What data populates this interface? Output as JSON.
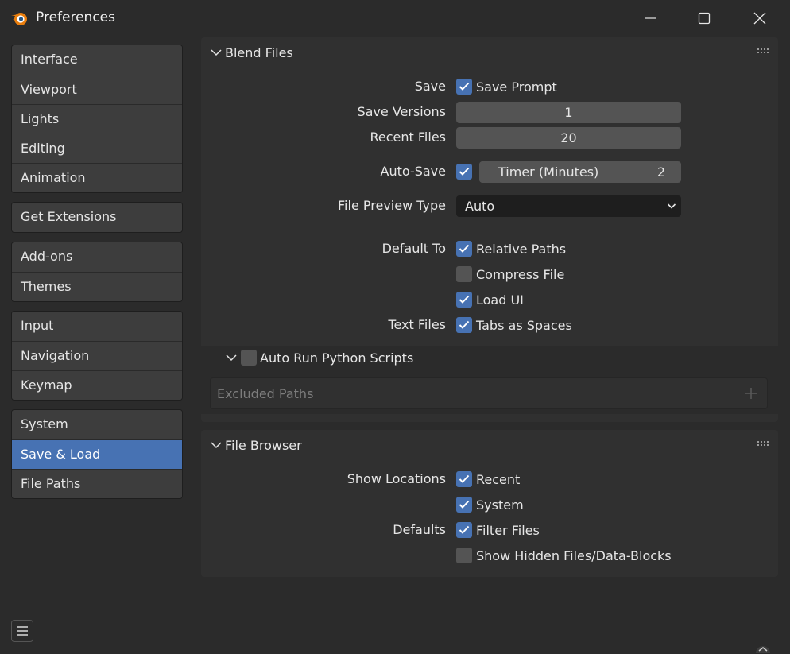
{
  "window": {
    "title": "Preferences"
  },
  "sidebar": {
    "groups": [
      [
        "Interface",
        "Viewport",
        "Lights",
        "Editing",
        "Animation"
      ],
      [
        "Get Extensions"
      ],
      [
        "Add-ons",
        "Themes"
      ],
      [
        "Input",
        "Navigation",
        "Keymap"
      ],
      [
        "System",
        "Save & Load",
        "File Paths"
      ]
    ],
    "items": {
      "interface": "Interface",
      "viewport": "Viewport",
      "lights": "Lights",
      "editing": "Editing",
      "animation": "Animation",
      "get_extensions": "Get Extensions",
      "addons": "Add-ons",
      "themes": "Themes",
      "input": "Input",
      "navigation": "Navigation",
      "keymap": "Keymap",
      "system": "System",
      "save_load": "Save & Load",
      "file_paths": "File Paths"
    },
    "active": "Save & Load"
  },
  "blend_files": {
    "title": "Blend Files",
    "save_label": "Save",
    "save_prompt": {
      "label": "Save Prompt",
      "checked": true
    },
    "save_versions": {
      "label": "Save Versions",
      "value": "1"
    },
    "recent_files": {
      "label": "Recent Files",
      "value": "20"
    },
    "auto_save": {
      "label": "Auto-Save",
      "checked": true,
      "timer_label": "Timer (Minutes)",
      "timer_value": "2"
    },
    "file_preview_type": {
      "label": "File Preview Type",
      "value": "Auto"
    },
    "default_to_label": "Default To",
    "relative_paths": {
      "label": "Relative Paths",
      "checked": true
    },
    "compress_file": {
      "label": "Compress File",
      "checked": false
    },
    "load_ui": {
      "label": "Load UI",
      "checked": true
    },
    "text_files_label": "Text Files",
    "tabs_as_spaces": {
      "label": "Tabs as Spaces",
      "checked": true
    },
    "auto_run": {
      "label": "Auto Run Python Scripts",
      "checked": false
    },
    "excluded_paths": "Excluded Paths"
  },
  "file_browser": {
    "title": "File Browser",
    "show_locations_label": "Show Locations",
    "recent": {
      "label": "Recent",
      "checked": true
    },
    "system": {
      "label": "System",
      "checked": true
    },
    "defaults_label": "Defaults",
    "filter_files": {
      "label": "Filter Files",
      "checked": true
    },
    "show_hidden": {
      "label": "Show Hidden Files/Data-Blocks",
      "checked": false
    }
  },
  "colors": {
    "accent": "#4772b3",
    "background": "#2b2b2b",
    "panel": "#303030",
    "widget": "#545454"
  },
  "icons": [
    "blender-logo-icon",
    "minimize-icon",
    "maximize-icon",
    "close-icon",
    "chevron-down-icon",
    "grip-icon",
    "checkmark-icon",
    "plus-icon",
    "hamburger-menu-icon"
  ]
}
